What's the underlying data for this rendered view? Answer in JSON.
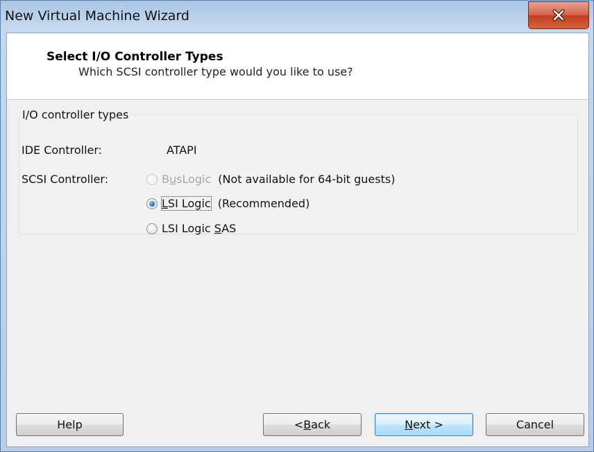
{
  "window": {
    "title": "New Virtual Machine Wizard"
  },
  "header": {
    "title": "Select I/O Controller Types",
    "subtitle": "Which SCSI controller type would you like to use?"
  },
  "controller_group": {
    "legend": "I/O controller types",
    "ide_label": "IDE Controller:",
    "ide_value": "ATAPI",
    "scsi_label": "SCSI Controller:",
    "options": [
      {
        "label": "BusLogic",
        "mnemonic": "u",
        "note": "(Not available for 64-bit guests)",
        "enabled": false,
        "selected": false
      },
      {
        "label": "LSI Logic",
        "mnemonic": "L",
        "note": "(Recommended)",
        "enabled": true,
        "selected": true
      },
      {
        "label": "LSI Logic SAS",
        "mnemonic": "S",
        "note": "",
        "enabled": true,
        "selected": false
      }
    ]
  },
  "buttons": {
    "help": "Help",
    "back": "< Back",
    "next": "Next >",
    "cancel": "Cancel"
  },
  "colors": {
    "close_button": "#c94a2c",
    "default_button_border": "#3c7fb1",
    "disabled_text": "#a6a6a6"
  },
  "icons": {
    "close": "close-x-icon"
  }
}
